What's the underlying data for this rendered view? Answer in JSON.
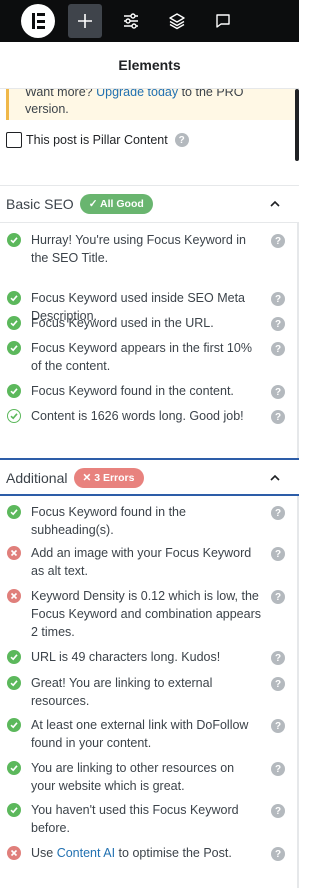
{
  "toolbar": {
    "logo_icon": "elementor-logo-icon",
    "buttons": [
      {
        "icon": "plus-icon",
        "active": true
      },
      {
        "icon": "sliders-icon"
      },
      {
        "icon": "layers-icon"
      },
      {
        "icon": "comment-icon"
      }
    ]
  },
  "panel": {
    "title": "Elements"
  },
  "notice": {
    "prefix": "Want more? ",
    "link": "Upgrade today",
    "middle": " to the PRO",
    "suffix": "version."
  },
  "pillar": {
    "label": "This post is Pillar Content",
    "help": "?"
  },
  "basic_seo": {
    "title": "Basic SEO",
    "badge": "✓ All Good",
    "items": [
      {
        "status": "ok",
        "text": "Hurray! You're using Focus Keyword in the SEO Title."
      },
      {
        "status": "ok",
        "text": "Focus Keyword used inside SEO Meta Description."
      },
      {
        "status": "ok",
        "text": "Focus Keyword used in the URL."
      },
      {
        "status": "ok",
        "text": "Focus Keyword appears in the first 10% of the content."
      },
      {
        "status": "ok",
        "text": "Focus Keyword found in the content."
      },
      {
        "status": "ok-outline",
        "text": "Content is 1626 words long. Good job!"
      }
    ]
  },
  "additional": {
    "title": "Additional",
    "badge": "✕ 3 Errors",
    "items": [
      {
        "status": "ok",
        "text": "Focus Keyword found in the subheading(s)."
      },
      {
        "status": "err",
        "text": "Add an image with your Focus Keyword as alt text."
      },
      {
        "status": "err",
        "text": "Keyword Density is 0.12 which is low, the Focus Keyword and combination appears 2 times."
      },
      {
        "status": "ok",
        "text": "URL is 49 characters long. Kudos!"
      },
      {
        "status": "ok",
        "text": "Great! You are linking to external resources."
      },
      {
        "status": "ok",
        "text": "At least one external link with DoFollow found in your content."
      },
      {
        "status": "ok",
        "text": "You are linking to other resources on your website which is great."
      },
      {
        "status": "ok",
        "text": "You haven't used this Focus Keyword before."
      },
      {
        "status": "err",
        "prefix": "Use ",
        "link": "Content AI",
        "suffix": " to optimise the Post."
      }
    ]
  },
  "help_glyph": "?",
  "colors": {
    "toolbar_bg": "#0c0d0e",
    "good": "#69b56f",
    "error": "#e8827e",
    "link": "#2271b1",
    "accent_divider": "#2d5da8"
  }
}
